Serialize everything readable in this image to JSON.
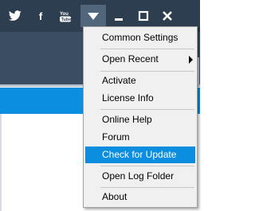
{
  "titlebar": {
    "icons": [
      "twitter-icon",
      "facebook-icon",
      "youtube-icon",
      "menu-dropdown-icon",
      "minimize-icon",
      "maximize-icon",
      "close-icon"
    ],
    "facebook_glyph": "f"
  },
  "colors": {
    "titlebar_bg": "#2d3e50",
    "accent": "#0c8ee0",
    "menu_bg": "#f0f0f0"
  },
  "menu": {
    "items": [
      {
        "label": "Common Settings"
      },
      {
        "label": "Open Recent"
      },
      {
        "label": "Activate"
      },
      {
        "label": "License Info"
      },
      {
        "label": "Online Help"
      },
      {
        "label": "Forum"
      },
      {
        "label": "Check for Update"
      },
      {
        "label": "Open Log Folder"
      },
      {
        "label": "About"
      }
    ],
    "highlighted_item": "Check for Update"
  }
}
